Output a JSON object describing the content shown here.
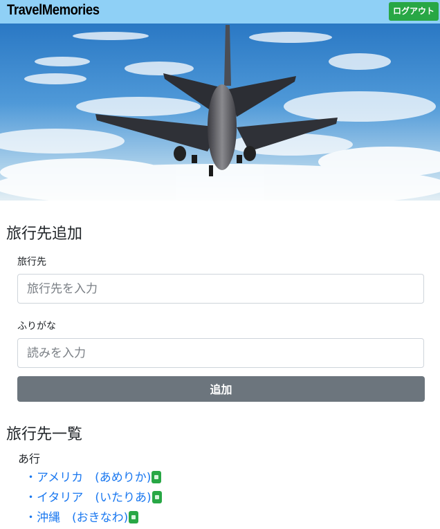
{
  "header": {
    "brand": "TravelMemories",
    "logout_label": "ログアウト"
  },
  "hero": {
    "image": "airplane-in-sky"
  },
  "add_section": {
    "title": "旅行先追加",
    "destination_label": "旅行先",
    "destination_placeholder": "旅行先を入力",
    "destination_value": "",
    "reading_label": "ふりがな",
    "reading_placeholder": "読みを入力",
    "reading_value": "",
    "submit_label": "追加"
  },
  "list_section": {
    "title": "旅行先一覧",
    "group_label": "あ行",
    "items": [
      {
        "text": "・アメリカ　(あめりか)"
      },
      {
        "text": "・イタリア　(いたりあ)"
      },
      {
        "text": "・沖縄　(おきなわ)"
      }
    ]
  },
  "colors": {
    "navbar": "#8fd0f6",
    "logout_button": "#28a745",
    "submit_button": "#6c757d",
    "link": "#1a78f0",
    "delete_button": "#28a745"
  }
}
